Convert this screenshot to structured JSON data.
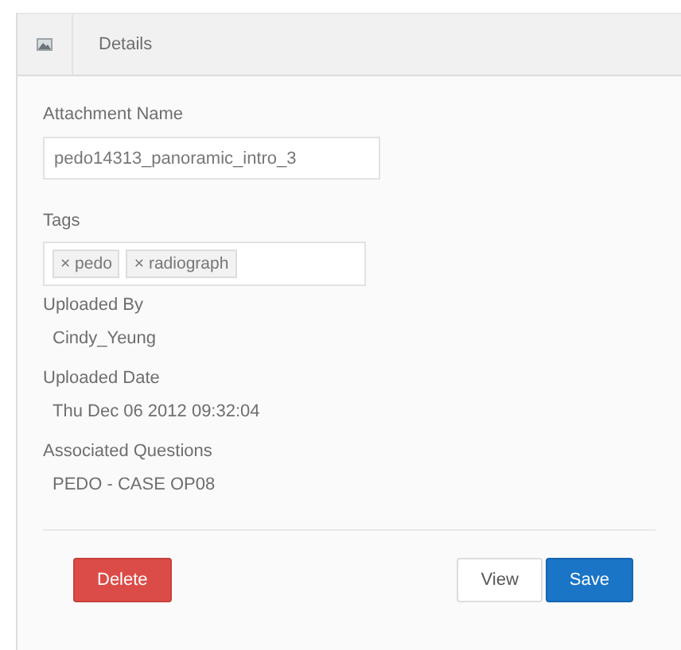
{
  "header": {
    "title": "Details"
  },
  "attachment_name": {
    "label": "Attachment Name",
    "value": "pedo14313_panoramic_intro_3"
  },
  "tags": {
    "label": "Tags",
    "items": [
      "pedo",
      "radiograph"
    ],
    "remove_glyph": "×"
  },
  "fields": [
    {
      "label": "Uploaded By",
      "value": "Cindy_Yeung"
    },
    {
      "label": "Uploaded Date",
      "value": "Thu Dec 06 2012 09:32:04"
    },
    {
      "label": "Associated Questions",
      "value": "PEDO - CASE OP08"
    }
  ],
  "buttons": [
    {
      "label": "Delete",
      "kind": "danger"
    },
    {
      "label": "View",
      "kind": "default"
    },
    {
      "label": "Save",
      "kind": "primary"
    }
  ]
}
